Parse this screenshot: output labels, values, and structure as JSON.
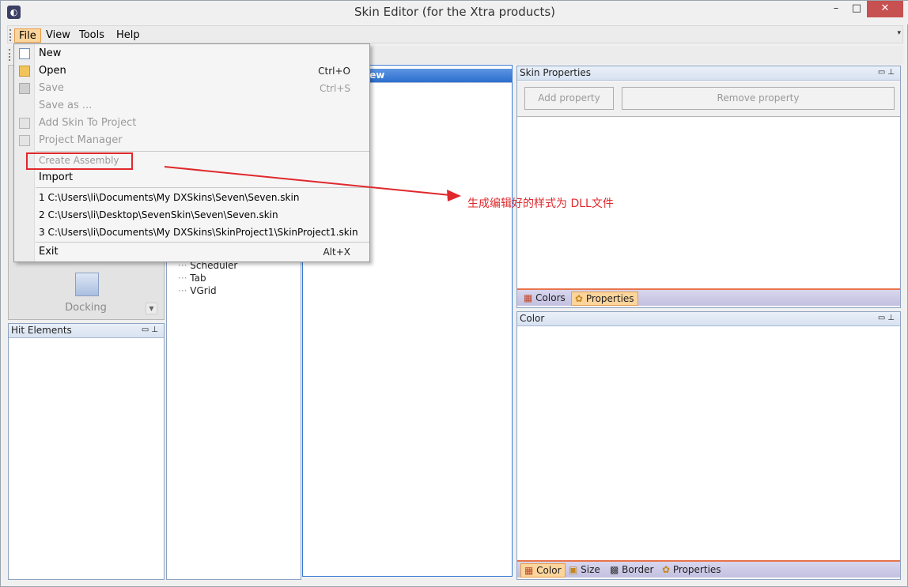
{
  "window": {
    "title": "Skin Editor (for the Xtra products)",
    "minimize": "–",
    "maximize": "□",
    "close": "✕"
  },
  "menubar": {
    "items": [
      {
        "label": "File",
        "key": "file"
      },
      {
        "label": "View",
        "key": "view"
      },
      {
        "label": "Tools",
        "key": "tools"
      },
      {
        "label": "Help",
        "key": "help"
      }
    ]
  },
  "file_menu": {
    "new": "New",
    "open": "Open",
    "open_shortcut": "Ctrl+O",
    "save": "Save",
    "save_shortcut": "Ctrl+S",
    "save_as": "Save as ...",
    "add_skin": "Add Skin To Project",
    "project_manager": "Project Manager",
    "create_assembly": "Create Assembly",
    "import": "Import",
    "recent_1": "1 C:\\Users\\li\\Documents\\My DXSkins\\Seven\\Seven.skin",
    "recent_2": "2 C:\\Users\\li\\Desktop\\SevenSkin\\Seven\\Seven.skin",
    "recent_3": "3 C:\\Users\\li\\Documents\\My DXSkins\\SkinProject1\\SkinProject1.skin",
    "exit": "Exit",
    "exit_shortcut": "Alt+X"
  },
  "left_panel": {
    "docking_label": "Docking"
  },
  "hit_elements": {
    "title": "Hit Elements"
  },
  "tree": {
    "items": [
      "Scheduler",
      "Tab",
      "VGrid"
    ]
  },
  "preview": {
    "title_fragment": "iew"
  },
  "skin_properties": {
    "title": "Skin Properties",
    "add_property": "Add property",
    "remove_property": "Remove property",
    "tabs": [
      "Colors",
      "Properties"
    ]
  },
  "color_panel": {
    "title": "Color",
    "tabs": [
      "Color",
      "Size",
      "Border",
      "Properties"
    ]
  },
  "annotation": {
    "text": "生成编辑好的样式为 DLL文件",
    "color": "#e0282c"
  },
  "colors": {
    "accent_orange": "#fbd59c",
    "panel_header": "#d8e2f1",
    "tab_strip": "#c2c0e0",
    "close_button": "#c75050"
  }
}
